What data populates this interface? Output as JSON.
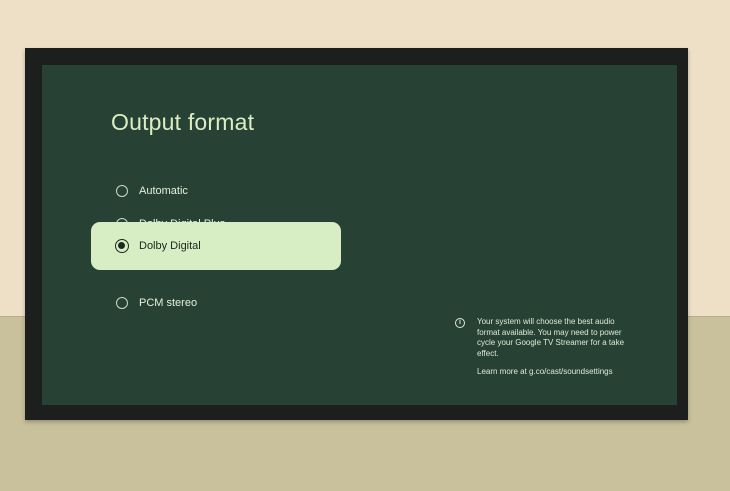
{
  "screen": {
    "title": "Output format",
    "options": [
      {
        "label": "Automatic",
        "selected": false
      },
      {
        "label": "Dolby Digital Plus",
        "selected": false
      },
      {
        "label": "Dolby Digital",
        "selected": true
      },
      {
        "label": "PCM stereo",
        "selected": false
      }
    ],
    "info": {
      "icon": "info-icon",
      "text": "Your system will choose the best audio format available. You may need to power cycle your Google TV Streamer for a take effect.",
      "link": "Learn more at g.co/cast/soundsettings"
    }
  },
  "colors": {
    "screen_bg": "#274234",
    "selected_bg": "#d7edc4",
    "title": "#dcedc4"
  }
}
